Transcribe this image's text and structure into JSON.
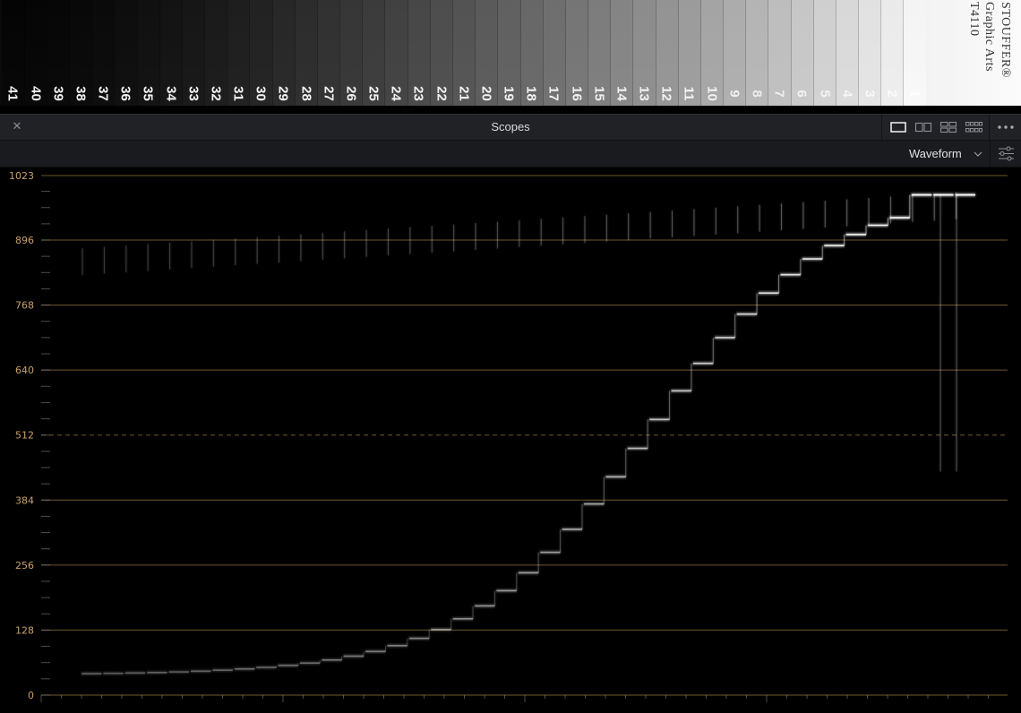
{
  "reference_image": {
    "steps": [
      "1",
      "2",
      "3",
      "4",
      "5",
      "6",
      "7",
      "8",
      "9",
      "10",
      "11",
      "12",
      "13",
      "14",
      "15",
      "16",
      "17",
      "18",
      "19",
      "20",
      "21",
      "22",
      "23",
      "24",
      "25",
      "26",
      "27",
      "28",
      "29",
      "30",
      "31",
      "32",
      "33",
      "34",
      "35",
      "36",
      "37",
      "38",
      "39",
      "40",
      "41"
    ],
    "brand_lines": [
      "STOUFFER®",
      "Graphic Arts",
      "T4110"
    ]
  },
  "panel": {
    "title": "Scopes",
    "close_icon": "close-icon",
    "layout_icons": [
      "single-view-icon",
      "dual-view-icon",
      "quad-view-icon",
      "multi-view-icon"
    ],
    "more_icon": "more-options-icon"
  },
  "toolbar": {
    "scope_type": "Waveform",
    "settings_icon": "settings-sliders-icon"
  },
  "scope": {
    "axis_labels": [
      "1023",
      "896",
      "768",
      "640",
      "512",
      "384",
      "256",
      "128",
      "0"
    ],
    "colors": {
      "background": "#000000",
      "graticule": "#7a6236",
      "label": "#c8a06a",
      "trace": "#ffffff",
      "panel_bg": "#202226"
    }
  }
}
